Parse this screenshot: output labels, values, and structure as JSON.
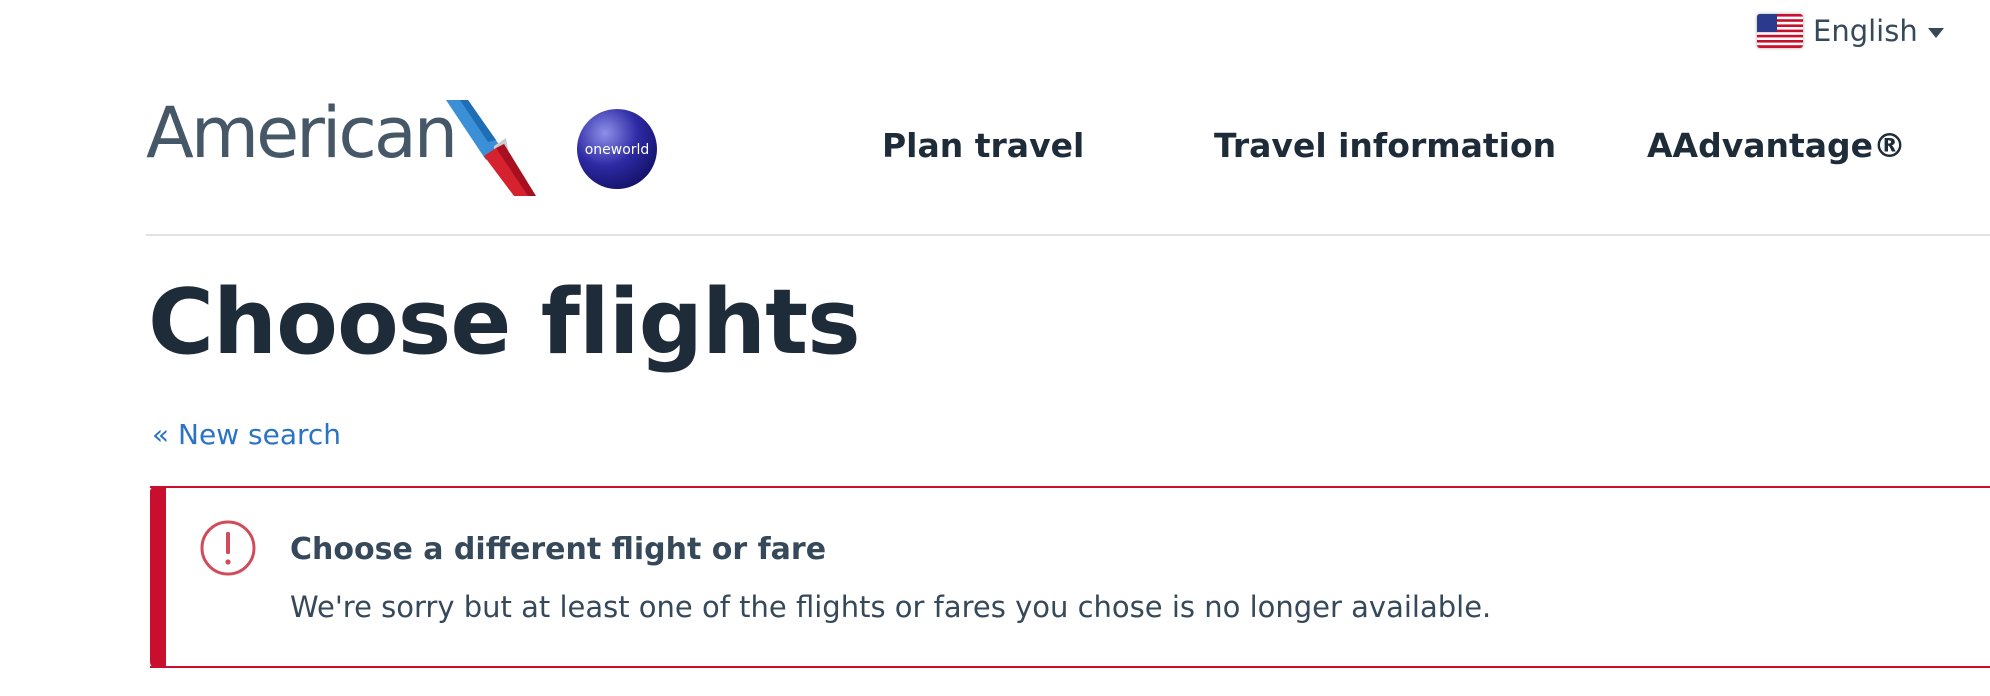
{
  "language": {
    "label": "English",
    "flag_icon": "us-flag-icon"
  },
  "brand": {
    "logo_text": "American",
    "flight_symbol": "american-flight-symbol-icon",
    "alliance_badge_text": "oneworld"
  },
  "nav": [
    {
      "label": "Plan travel"
    },
    {
      "label": "Travel information"
    },
    {
      "label": "AAdvantage®"
    }
  ],
  "page": {
    "title": "Choose flights",
    "new_search_link": "« New search"
  },
  "alert": {
    "icon": "error-exclamation-icon",
    "title": "Choose a different flight or fare",
    "message": "We're sorry but at least one of the flights or fares you chose is no longer available."
  },
  "colors": {
    "error": "#c8102e",
    "link": "#2a73c5",
    "heading": "#1e2b38",
    "body_text": "#36495a"
  }
}
